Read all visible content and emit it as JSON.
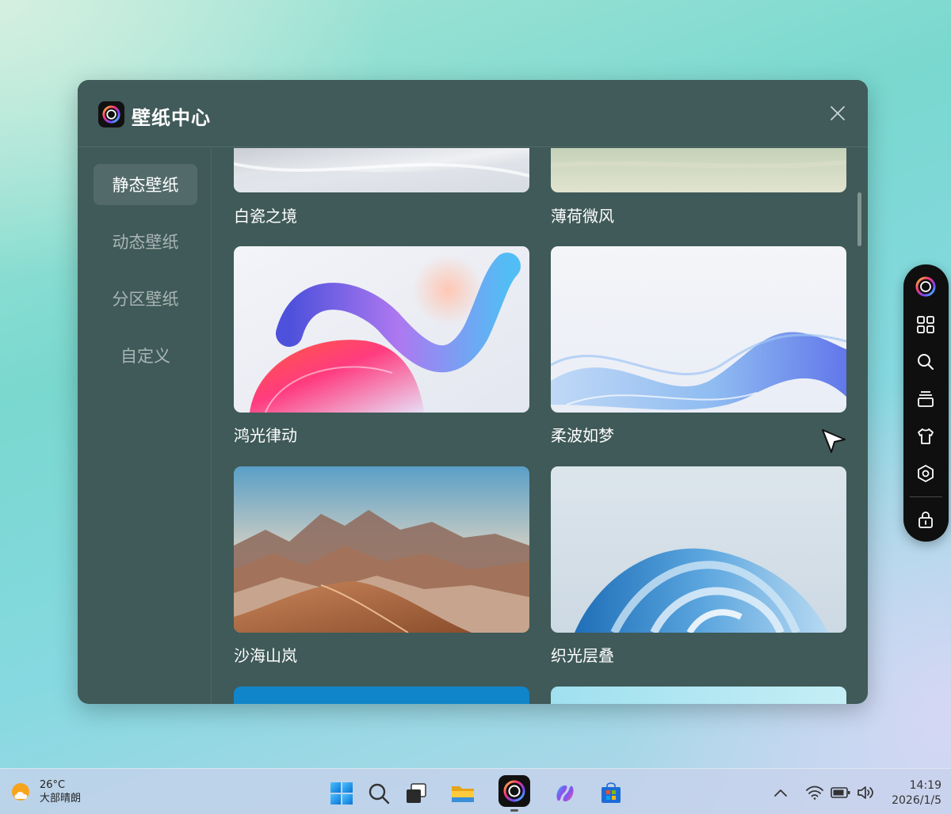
{
  "window": {
    "title": "壁纸中心",
    "nav": [
      {
        "label": "静态壁纸",
        "active": true
      },
      {
        "label": "动态壁纸",
        "active": false
      },
      {
        "label": "分区壁纸",
        "active": false
      },
      {
        "label": "自定义",
        "active": false
      }
    ],
    "wallpapers": [
      {
        "name": "白瓷之境"
      },
      {
        "name": "薄荷微风"
      },
      {
        "name": "鸿光律动"
      },
      {
        "name": "柔波如梦"
      },
      {
        "name": "沙海山岚"
      },
      {
        "name": "织光层叠"
      }
    ]
  },
  "toolbar": {
    "icons": [
      "app-logo-icon",
      "grid-icon",
      "search-icon",
      "stack-icon",
      "shirt-icon",
      "settings-icon",
      "lock-icon"
    ]
  },
  "taskbar": {
    "weather": {
      "temp": "26°C",
      "desc": "大部晴朗"
    },
    "clock": {
      "time": "14:19",
      "date": "2026/1/5"
    },
    "icons": [
      "windows-start-icon",
      "search-icon",
      "task-view-icon",
      "file-explorer-icon",
      "wallpaper-app-icon",
      "copilot-icon",
      "store-icon"
    ]
  },
  "colors": {
    "window_bg": "#3f5a58",
    "toolbar_bg": "#0f0f10",
    "accent_ring": "#a050ff"
  }
}
